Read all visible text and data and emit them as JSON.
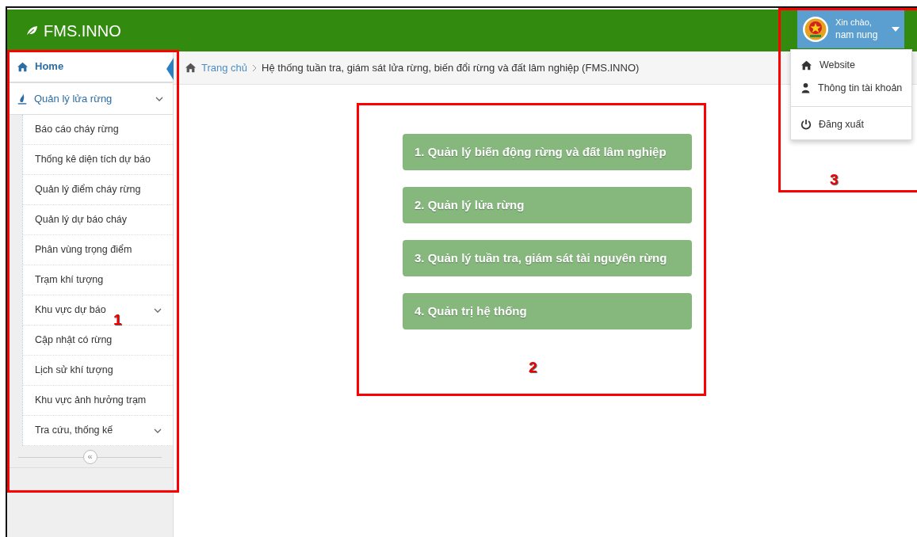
{
  "header": {
    "brand": "FMS.INNO"
  },
  "user": {
    "greeting": "Xin chào,",
    "name": "nam nung"
  },
  "user_menu": [
    {
      "label": "Website",
      "kind": "home",
      "divider_before": false
    },
    {
      "label": "Thông tin tài khoản",
      "kind": "person",
      "divider_before": false
    },
    {
      "label": "Đăng xuất",
      "kind": "power",
      "divider_before": true
    }
  ],
  "sidebar": {
    "items": [
      {
        "label": "Home",
        "kind": "home",
        "selected": true
      },
      {
        "label": "Quản lý lửa rừng",
        "kind": "fire",
        "selected": false,
        "expanded": true,
        "children": [
          {
            "label": "Báo cáo cháy rừng",
            "expandable": false
          },
          {
            "label": "Thống kê diện tích dự báo",
            "expandable": false
          },
          {
            "label": "Quản lý điểm cháy rừng",
            "expandable": false
          },
          {
            "label": "Quản lý dự báo cháy",
            "expandable": false
          },
          {
            "label": "Phân vùng trọng điểm",
            "expandable": false
          },
          {
            "label": "Trạm khí tượng",
            "expandable": false
          },
          {
            "label": "Khu vực dự báo",
            "expandable": true
          },
          {
            "label": "Cập nhật có rừng",
            "expandable": false
          },
          {
            "label": "Lịch sử khí tượng",
            "expandable": false
          },
          {
            "label": "Khu vực ảnh hưởng trạm",
            "expandable": false
          },
          {
            "label": "Tra cứu, thống kế",
            "expandable": true
          }
        ]
      }
    ],
    "collapse_button": "«"
  },
  "breadcrumb": [
    {
      "label": "Trang chủ",
      "link": true
    },
    {
      "label": "Hệ thống tuần tra, giám sát lửa rừng, biến đổi rừng và đất lâm nghiệp (FMS.INNO)",
      "link": false
    }
  ],
  "modules": [
    "1. Quản lý biến động rừng và đất lâm nghiệp",
    "2. Quản lý lửa rừng",
    "3. Quản lý tuần tra, giám sát tài nguyên rừng",
    "4. Quản trị hệ thống"
  ],
  "annotations": [
    {
      "label": "1"
    },
    {
      "label": "2"
    },
    {
      "label": "3"
    }
  ]
}
